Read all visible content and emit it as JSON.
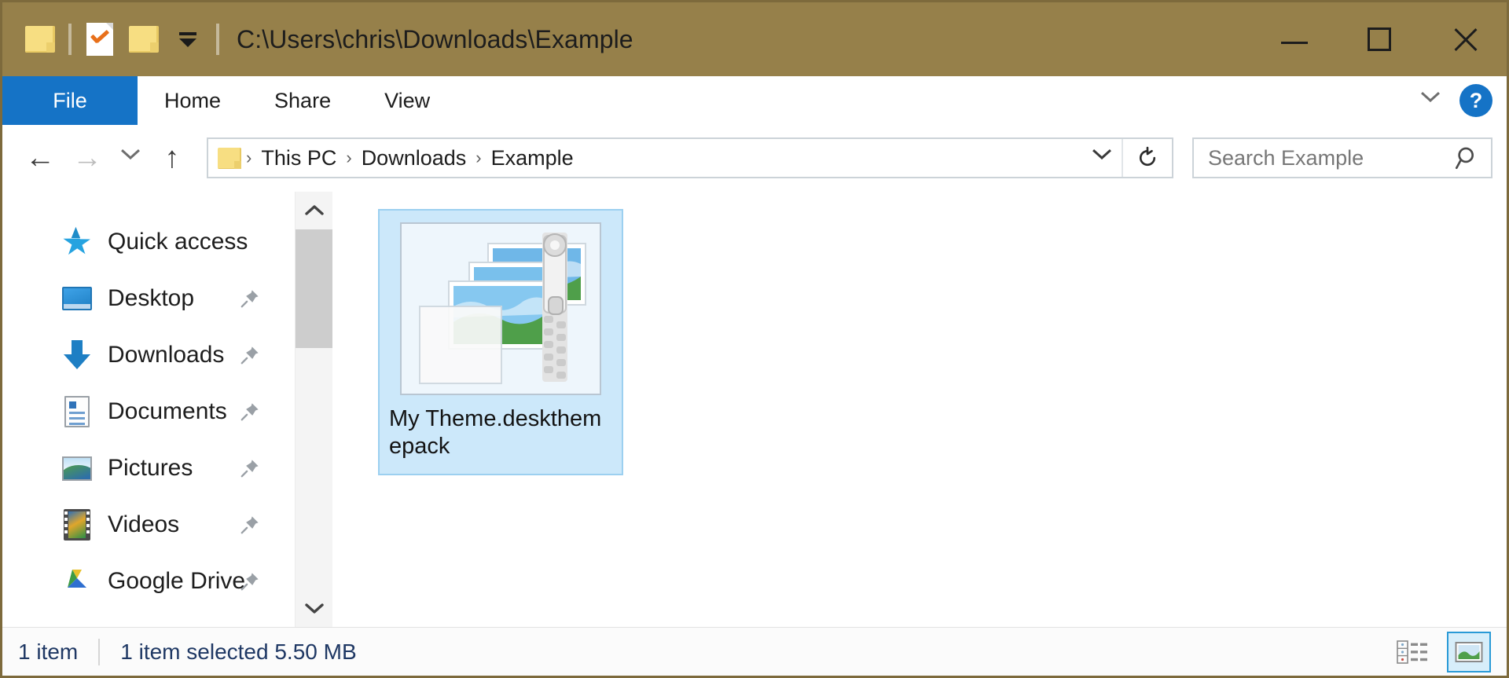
{
  "window": {
    "title": "C:\\Users\\chris\\Downloads\\Example",
    "titlebar_color": "#96804a",
    "accent_color": "#1573c6"
  },
  "quick_access_toolbar": {
    "system_menu_icon": "folder-icon",
    "properties_icon": "properties-check-icon",
    "new_folder_icon": "new-folder-icon",
    "customize_icon": "dropdown-caret-icon"
  },
  "window_controls": {
    "minimize": "minimize-icon",
    "maximize": "maximize-icon",
    "close": "close-icon"
  },
  "ribbon": {
    "tabs": [
      {
        "label": "File",
        "active": true
      },
      {
        "label": "Home",
        "active": false
      },
      {
        "label": "Share",
        "active": false
      },
      {
        "label": "View",
        "active": false
      }
    ],
    "expand_icon": "chevron-down-icon",
    "help_label": "?"
  },
  "addressbar": {
    "back_icon": "←",
    "forward_icon": "→",
    "recent_icon": "chevron-down-icon",
    "up_icon": "↑",
    "breadcrumb": [
      "This PC",
      "Downloads",
      "Example"
    ],
    "separator": "›",
    "dropdown_icon": "chevron-down-icon",
    "refresh_icon": "refresh-icon"
  },
  "search": {
    "placeholder": "Search Example",
    "value": "",
    "icon": "search-icon"
  },
  "navigation_pane": {
    "items": [
      {
        "label": "Quick access",
        "icon": "star-icon",
        "pinned": false
      },
      {
        "label": "Desktop",
        "icon": "desktop-icon",
        "pinned": true
      },
      {
        "label": "Downloads",
        "icon": "downloads-icon",
        "pinned": true
      },
      {
        "label": "Documents",
        "icon": "documents-icon",
        "pinned": true
      },
      {
        "label": "Pictures",
        "icon": "pictures-icon",
        "pinned": true
      },
      {
        "label": "Videos",
        "icon": "videos-icon",
        "pinned": true
      },
      {
        "label": "Google Drive",
        "icon": "google-drive-icon",
        "pinned": true
      }
    ],
    "scrollbar": {
      "up_icon": "chevron-up-icon",
      "down_icon": "chevron-down-icon",
      "thumb_position": "top"
    }
  },
  "content": {
    "files": [
      {
        "name": "My Theme.deskthemepack",
        "icon": "deskthemepack-icon",
        "selected": true
      }
    ]
  },
  "statusbar": {
    "item_count": "1 item",
    "selection": "1 item selected  5.50 MB",
    "views": [
      {
        "name": "details-view",
        "active": false
      },
      {
        "name": "large-icons-view",
        "active": true
      }
    ]
  }
}
